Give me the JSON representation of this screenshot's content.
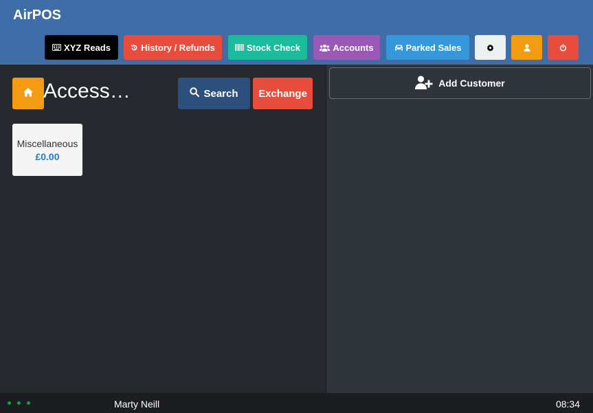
{
  "app": {
    "title": "AirPOS"
  },
  "toolbar": {
    "xyz_label": "XYZ Reads",
    "history_label": "History / Refunds",
    "stock_label": "Stock Check",
    "accounts_label": "Accounts",
    "parked_label": "Parked Sales"
  },
  "category": {
    "title": "Access…"
  },
  "actions": {
    "search_label": "Search",
    "exchange_label": "Exchange"
  },
  "products": [
    {
      "name": "Miscellaneous",
      "price": "£0.00"
    }
  ],
  "customer": {
    "add_label": "Add Customer"
  },
  "status": {
    "user": "Marty Neill",
    "time": "08:34"
  },
  "colors": {
    "header": "#3e6da8",
    "accent_orange": "#f39c12",
    "accent_red": "#e74c3c",
    "accent_teal": "#1abc9c",
    "accent_purple": "#9b59b6",
    "accent_blue": "#3498db",
    "search_blue": "#2c4f7c",
    "connection_green": "#1e9e3a"
  }
}
